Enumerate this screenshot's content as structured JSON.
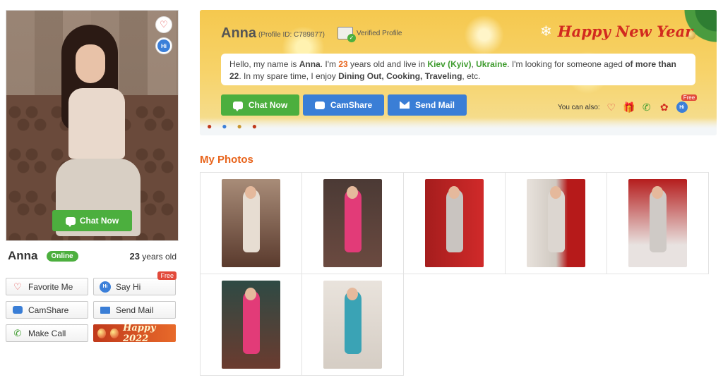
{
  "profile": {
    "name": "Anna",
    "status": "Online",
    "age_number": "23",
    "age_suffix": "years old",
    "profile_id_label": "(Profile ID: C789877)",
    "verified_label": "Verified Profile"
  },
  "main_photo": {
    "chat_now_label": "Chat Now"
  },
  "left_actions": {
    "favorite_label": "Favorite Me",
    "say_hi_label": "Say Hi",
    "free_badge": "Free",
    "camshare_label": "CamShare",
    "send_mail_label": "Send Mail",
    "make_call_label": "Make Call",
    "happy_label": "Happy 2022"
  },
  "banner": {
    "happy_new_year": "Happy New Year",
    "about": {
      "p1": "Hello, my name is ",
      "name": "Anna",
      "p2": ". I'm ",
      "age": "23",
      "p3": " years old and live in ",
      "city": "Kiev (Kyiv)",
      "p4": ", ",
      "country": "Ukraine",
      "p5": ". I'm looking for someone aged ",
      "seek_age": "of more than 22",
      "p6": ". In my spare time, I enjoy ",
      "hobbies": "Dining Out, Cooking, Traveling",
      "p7": ", etc."
    },
    "chat_now_label": "Chat Now",
    "camshare_label": "CamShare",
    "send_mail_label": "Send Mail",
    "you_can_also": "You can also:",
    "free_badge": "Free",
    "hi_text": "Hi"
  },
  "photos": {
    "title": "My Photos",
    "count": 7
  },
  "colors": {
    "accent_orange": "#e8631a",
    "green": "#4caf3e",
    "blue": "#3a7ed6",
    "red": "#d22a1f"
  },
  "icons": [
    "heart-plus-icon",
    "hi-bubble-icon",
    "chat-bubble-icon",
    "camera-icon",
    "mail-icon",
    "phone-icon",
    "gift-icon",
    "rose-icon",
    "verified-id-icon",
    "snowflake-icon",
    "ornament-icon"
  ]
}
